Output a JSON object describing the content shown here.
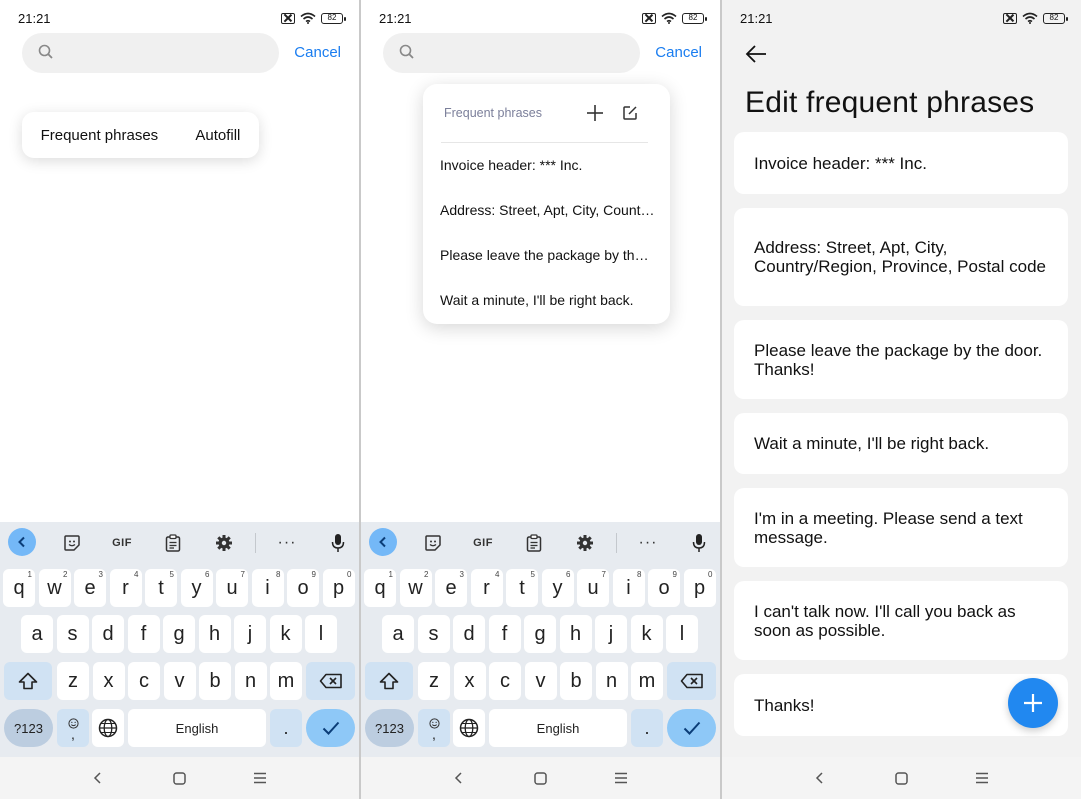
{
  "status": {
    "time": "21:21",
    "battery": "82"
  },
  "search": {
    "cancel_label": "Cancel"
  },
  "panel1": {
    "chips": [
      "Frequent phrases",
      "Autofill"
    ]
  },
  "panel2": {
    "header": "Frequent phrases",
    "items": [
      "Invoice header: *** Inc.",
      "Address: Street, Apt, City, Country/Region, Province, Postal code",
      "Please leave the package by the door. Thanks!",
      "Wait a minute, I'll be right back."
    ]
  },
  "keyboard": {
    "toolbar": {
      "gif_label": "GIF",
      "more_label": "···"
    },
    "row1": [
      {
        "key": "q",
        "hint": "1"
      },
      {
        "key": "w",
        "hint": "2"
      },
      {
        "key": "e",
        "hint": "3"
      },
      {
        "key": "r",
        "hint": "4"
      },
      {
        "key": "t",
        "hint": "5"
      },
      {
        "key": "y",
        "hint": "6"
      },
      {
        "key": "u",
        "hint": "7"
      },
      {
        "key": "i",
        "hint": "8"
      },
      {
        "key": "o",
        "hint": "9"
      },
      {
        "key": "p",
        "hint": "0"
      }
    ],
    "row2": [
      "a",
      "s",
      "d",
      "f",
      "g",
      "h",
      "j",
      "k",
      "l"
    ],
    "row3": [
      "z",
      "x",
      "c",
      "v",
      "b",
      "n",
      "m"
    ],
    "symbols_label": "?123",
    "emoji_comma_label": ",",
    "space_label": "English",
    "period_label": "."
  },
  "panel3": {
    "title": "Edit frequent phrases",
    "phrases": [
      "Invoice header: *** Inc.",
      "Address: Street, Apt, City, Country/Region, Province, Postal code",
      "Please leave the package by the door. Thanks!",
      "Wait a minute, I'll be right back.",
      "I'm in a meeting. Please send a text message.",
      "I can't talk now. I'll call you back as soon as possible.",
      "Thanks!"
    ]
  },
  "colors": {
    "accent": "#1a7df0",
    "fab": "#2188f0",
    "key_enter": "#8ec8f7"
  },
  "icons": [
    "search-icon",
    "add-icon",
    "edit-icon",
    "back-arrow-icon",
    "sticker-icon",
    "clipboard-icon",
    "settings-icon",
    "mic-icon",
    "shift-icon",
    "backspace-icon",
    "globe-icon",
    "check-icon",
    "nav-back-icon",
    "nav-home-icon",
    "nav-recents-icon"
  ]
}
